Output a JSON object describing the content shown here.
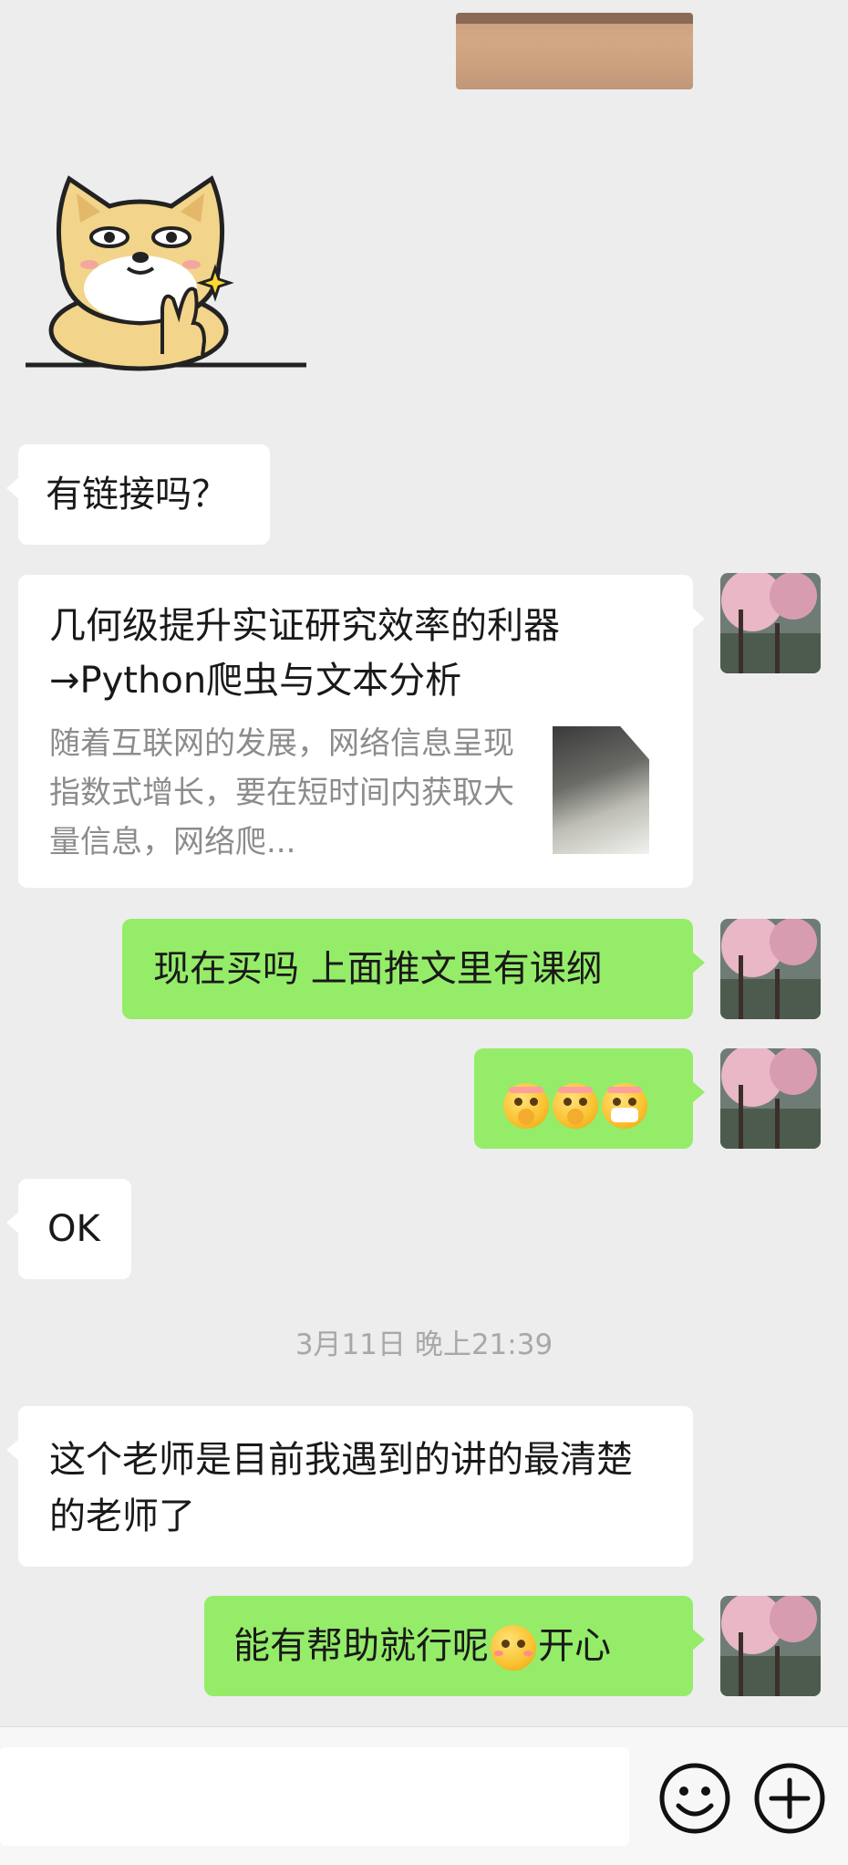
{
  "messages": {
    "ask_link": "有链接吗？",
    "link_card": {
      "title": "几何级提升实证研究效率的利器→Python爬虫与文本分析",
      "description": "随着互联网的发展，网络信息呈现指数式增长，要在短时间内获取大量信息，网络爬..."
    },
    "buy_now": "现在买吗 上面推文里有课纲",
    "ok": "OK",
    "timestamp": "3月11日 晚上21:39",
    "praise": "这个老师是目前我遇到的讲的最清楚的老师了",
    "reply_part1": "能有帮助就行呢",
    "reply_part2": "开心"
  },
  "icons": {
    "emoji_button": "smiley-icon",
    "more_button": "plus-circle-icon"
  },
  "colors": {
    "chat_background": "#ededed",
    "sent_bubble": "#95ec69",
    "received_bubble": "#ffffff",
    "timestamp_text": "#a8a8a8"
  }
}
